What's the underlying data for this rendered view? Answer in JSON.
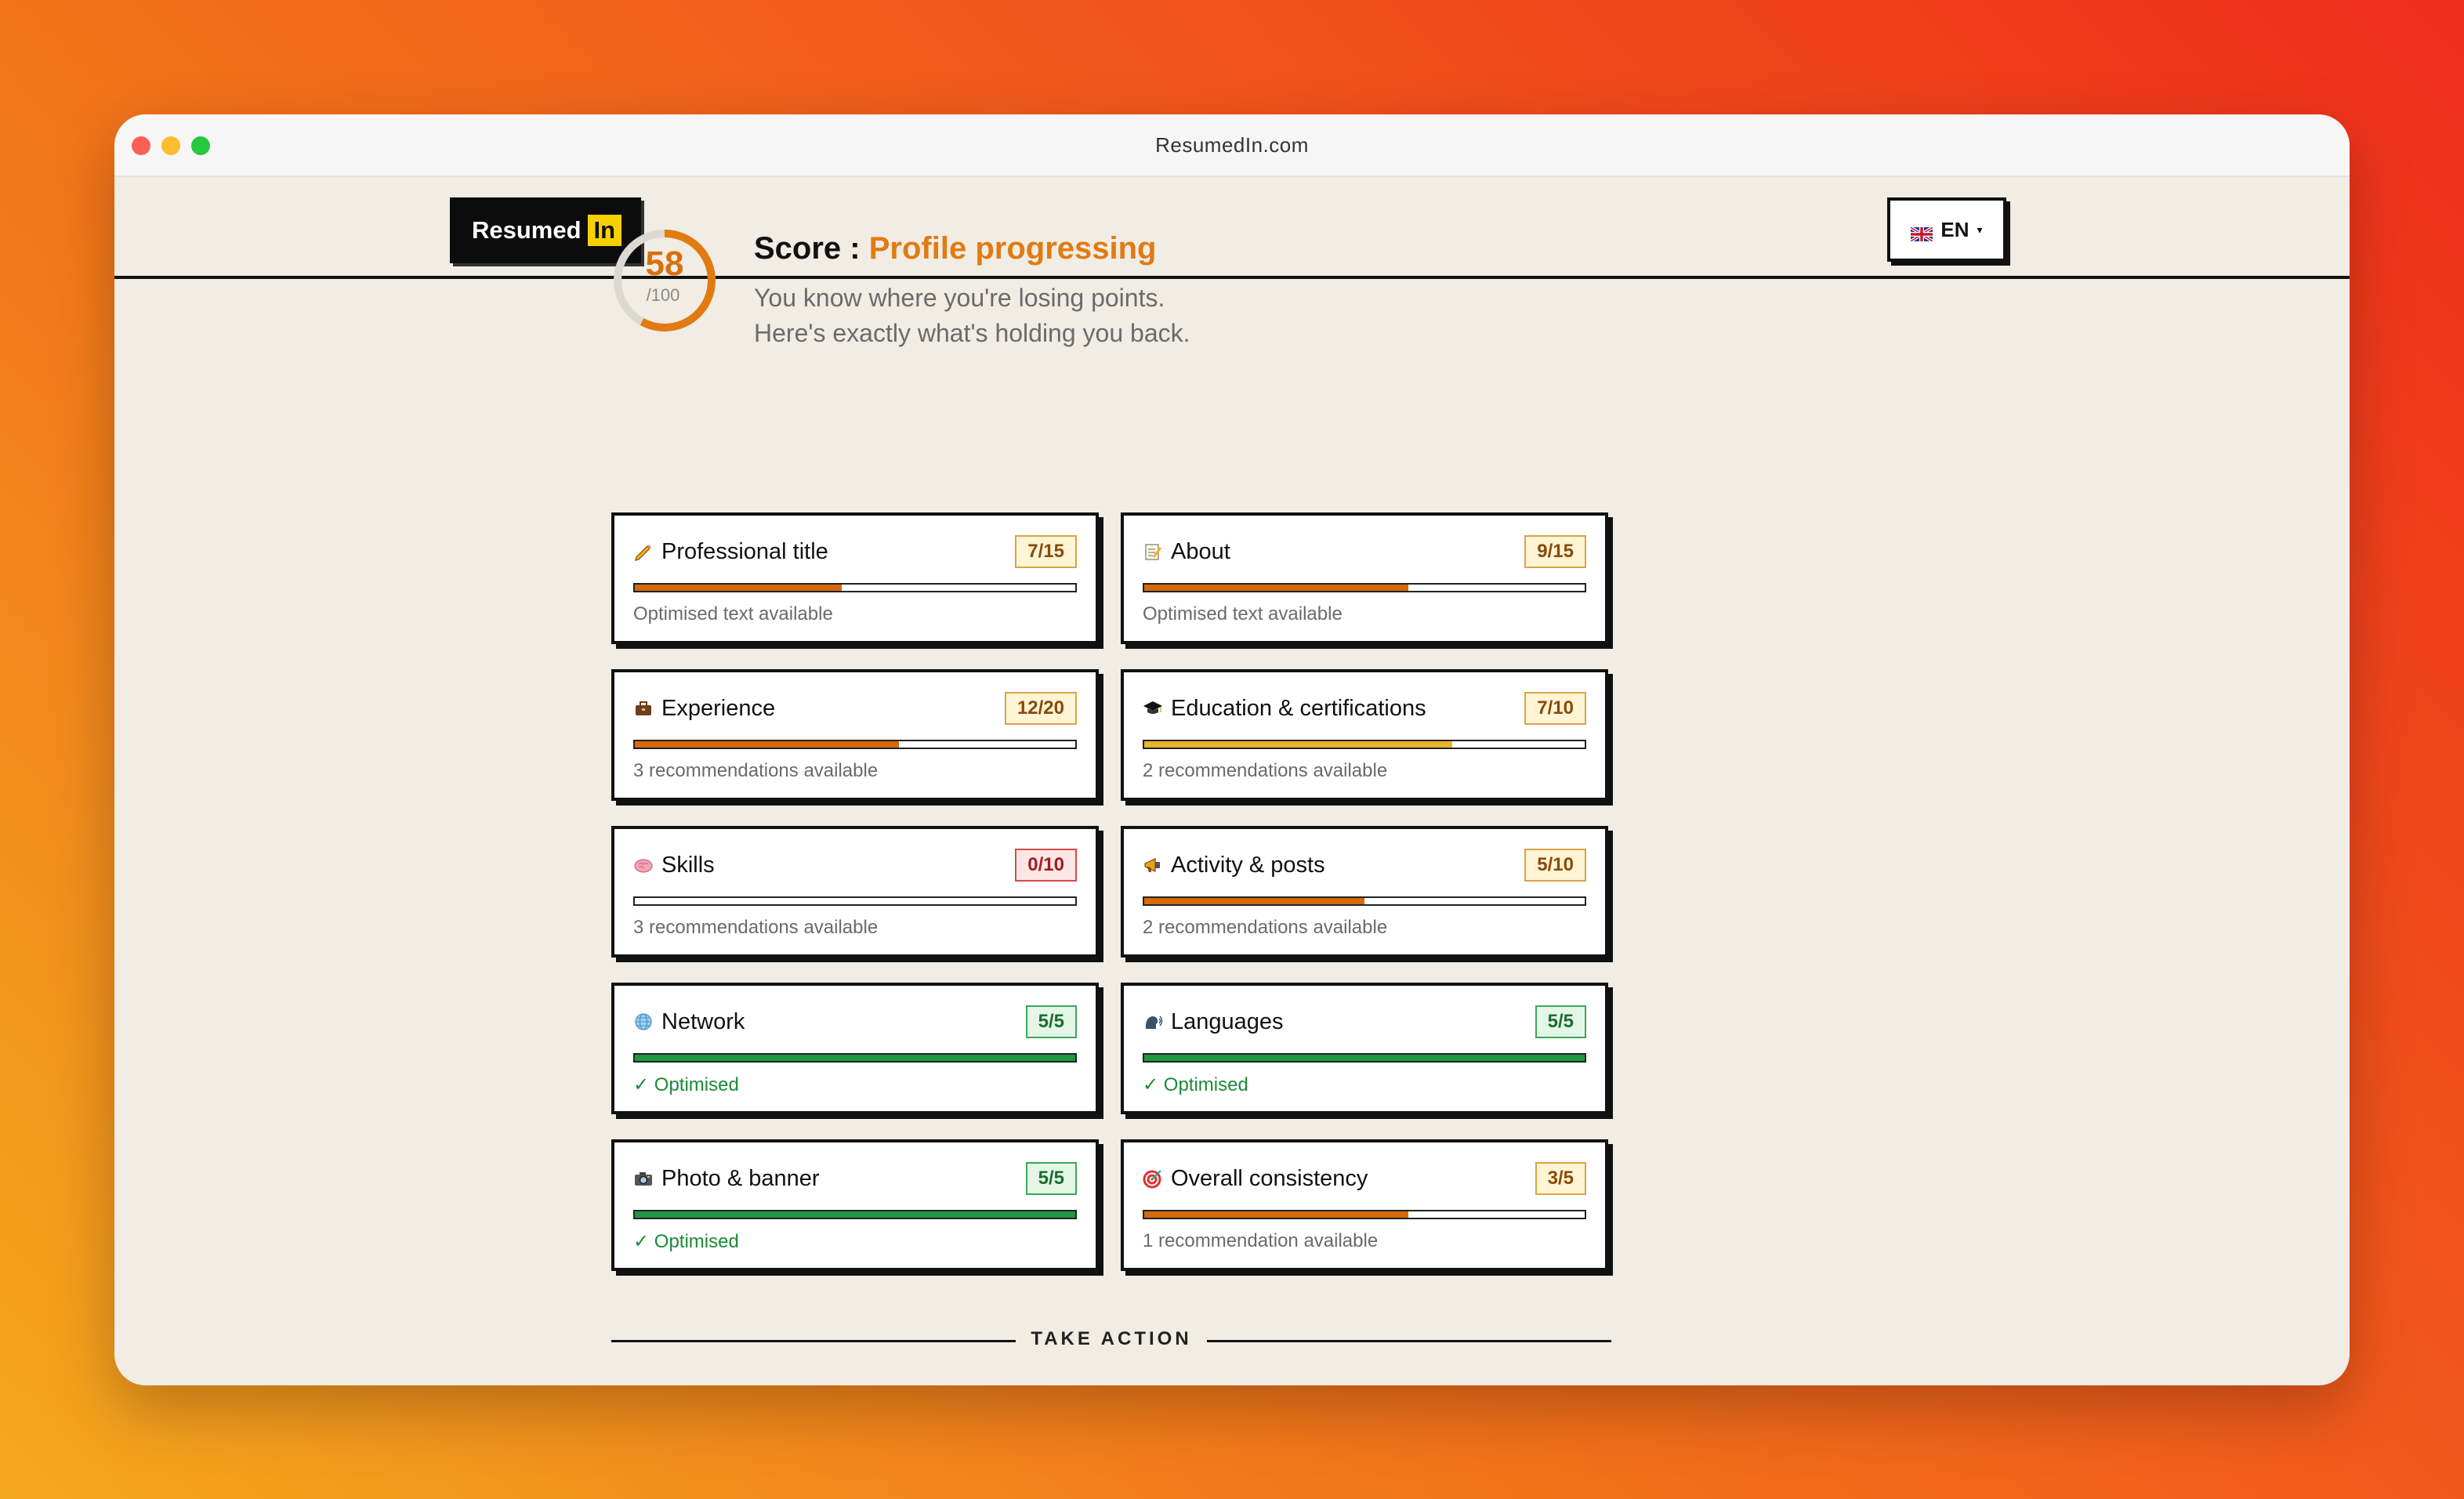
{
  "browser": {
    "url": "ResumedIn.com"
  },
  "header": {
    "logo_text": "Resumed",
    "logo_highlight": "In",
    "lang_label": "EN"
  },
  "score": {
    "value": "58",
    "max": "/100",
    "fraction": 0.58,
    "label": "Score :",
    "status": "Profile progressing",
    "sub1": "You know where you're losing points.",
    "sub2": "Here's exactly what's holding you back."
  },
  "cards": [
    {
      "icon": "pencil-icon",
      "title": "Professional title",
      "score": "7/15",
      "fraction": 0.47,
      "status": "warn",
      "fill": "orange",
      "note": "Optimised text available"
    },
    {
      "icon": "memo-icon",
      "title": "About",
      "score": "9/15",
      "fraction": 0.6,
      "status": "warn",
      "fill": "orange",
      "note": "Optimised text available"
    },
    {
      "icon": "briefcase-icon",
      "title": "Experience",
      "score": "12/20",
      "fraction": 0.6,
      "status": "warn",
      "fill": "orange",
      "note": "3 recommendations available"
    },
    {
      "icon": "graduation-cap-icon",
      "title": "Education & certifications",
      "score": "7/10",
      "fraction": 0.7,
      "status": "warn",
      "fill": "yellow",
      "note": "2 recommendations available"
    },
    {
      "icon": "brain-icon",
      "title": "Skills",
      "score": "0/10",
      "fraction": 0.0,
      "status": "bad",
      "fill": "orange",
      "note": "3 recommendations available"
    },
    {
      "icon": "megaphone-icon",
      "title": "Activity & posts",
      "score": "5/10",
      "fraction": 0.5,
      "status": "warn",
      "fill": "orange",
      "note": "2 recommendations available"
    },
    {
      "icon": "globe-icon",
      "title": "Network",
      "score": "5/5",
      "fraction": 1.0,
      "status": "good",
      "fill": "green",
      "note": "✓ Optimised"
    },
    {
      "icon": "speaking-head-icon",
      "title": "Languages",
      "score": "5/5",
      "fraction": 1.0,
      "status": "good",
      "fill": "green",
      "note": "✓ Optimised"
    },
    {
      "icon": "camera-icon",
      "title": "Photo & banner",
      "score": "5/5",
      "fraction": 1.0,
      "status": "good",
      "fill": "green",
      "note": "✓ Optimised"
    },
    {
      "icon": "target-icon",
      "title": "Overall consistency",
      "score": "3/5",
      "fraction": 0.6,
      "status": "warn",
      "fill": "orange",
      "note": "1 recommendation available"
    }
  ],
  "footer": {
    "action_label": "TAKE ACTION"
  },
  "colors": {
    "accent": "#e07b12",
    "good": "#1f9940",
    "bad": "#d74a4a",
    "warn_bg": "#fff4d4"
  }
}
